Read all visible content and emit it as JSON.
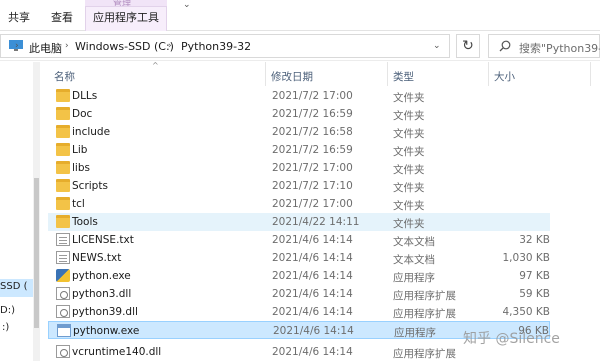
{
  "ribbon": {
    "tabs": [
      "共享",
      "查看"
    ],
    "context_group_caption": "管理",
    "context_tab": "应用程序工具"
  },
  "address": {
    "segments": [
      "此电脑",
      "Windows-SSD (C:)",
      "Python39-32"
    ]
  },
  "search": {
    "placeholder": "搜索\"Python39-3"
  },
  "nav": {
    "items": [
      "SSD (",
      "D:)",
      ":)"
    ]
  },
  "columns": {
    "name": "名称",
    "date": "修改日期",
    "type": "类型",
    "size": "大小"
  },
  "files": [
    {
      "name": "DLLs",
      "date": "2021/7/2 17:00",
      "type": "文件夹",
      "size": "",
      "icon": "folder-icon"
    },
    {
      "name": "Doc",
      "date": "2021/7/2 16:59",
      "type": "文件夹",
      "size": "",
      "icon": "folder-icon"
    },
    {
      "name": "include",
      "date": "2021/7/2 16:58",
      "type": "文件夹",
      "size": "",
      "icon": "folder-icon"
    },
    {
      "name": "Lib",
      "date": "2021/7/2 16:59",
      "type": "文件夹",
      "size": "",
      "icon": "folder-icon"
    },
    {
      "name": "libs",
      "date": "2021/7/2 17:00",
      "type": "文件夹",
      "size": "",
      "icon": "folder-icon"
    },
    {
      "name": "Scripts",
      "date": "2021/7/2 17:10",
      "type": "文件夹",
      "size": "",
      "icon": "folder-icon"
    },
    {
      "name": "tcl",
      "date": "2021/7/2 17:00",
      "type": "文件夹",
      "size": "",
      "icon": "folder-icon"
    },
    {
      "name": "Tools",
      "date": "2021/4/22 14:11",
      "type": "文件夹",
      "size": "",
      "icon": "folder-icon"
    },
    {
      "name": "LICENSE.txt",
      "date": "2021/4/6 14:14",
      "type": "文本文档",
      "size": "32 KB",
      "icon": "text-file-icon"
    },
    {
      "name": "NEWS.txt",
      "date": "2021/4/6 14:14",
      "type": "文本文档",
      "size": "1,030 KB",
      "icon": "text-file-icon"
    },
    {
      "name": "python.exe",
      "date": "2021/4/6 14:14",
      "type": "应用程序",
      "size": "97 KB",
      "icon": "python-exe-icon"
    },
    {
      "name": "python3.dll",
      "date": "2021/4/6 14:14",
      "type": "应用程序扩展",
      "size": "59 KB",
      "icon": "dll-file-icon"
    },
    {
      "name": "python39.dll",
      "date": "2021/4/6 14:14",
      "type": "应用程序扩展",
      "size": "4,350 KB",
      "icon": "dll-file-icon"
    },
    {
      "name": "pythonw.exe",
      "date": "2021/4/6 14:14",
      "type": "应用程序",
      "size": "96 KB",
      "icon": "window-exe-icon"
    },
    {
      "name": "vcruntime140.dll",
      "date": "2021/4/6 14:14",
      "type": "应用程序扩展",
      "size": "",
      "icon": "dll-file-icon"
    }
  ],
  "state": {
    "highlighted_row": "Tools",
    "selected_row": "pythonw.exe"
  },
  "watermark": "知乎 @Silence"
}
